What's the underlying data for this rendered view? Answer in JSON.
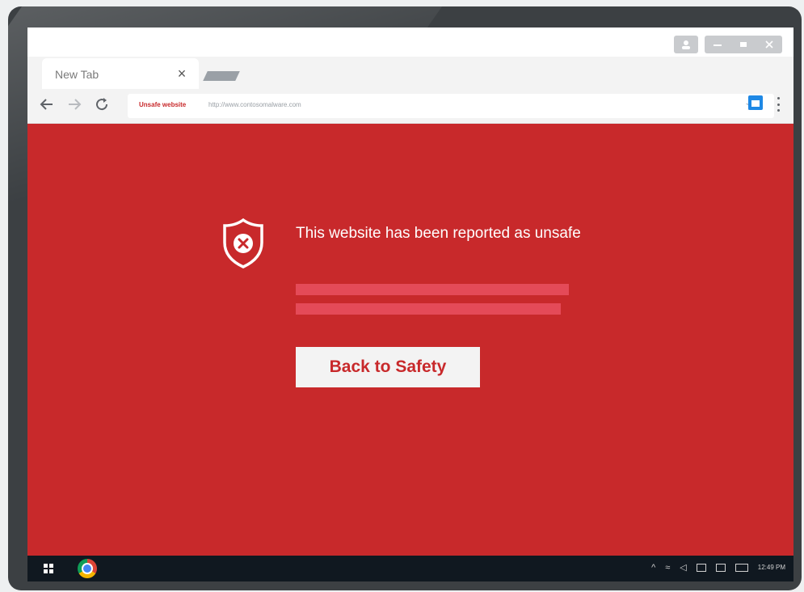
{
  "browser": {
    "tab_title": "New Tab",
    "tab_close_glyph": "×",
    "address_bar": {
      "security_label": "Unsafe website",
      "url": "http://www.contosomalware.com"
    }
  },
  "warning": {
    "icon": "shield-x-icon",
    "message": "This website has been reported as unsafe",
    "button_label": "Back to Safety"
  },
  "taskbar": {
    "clock": "12:49 PM"
  },
  "colors": {
    "danger_background": "#c8292b",
    "redacted_bar": "#e44a58",
    "taskbar": "#101820",
    "button_bg": "#f3f3f3"
  }
}
